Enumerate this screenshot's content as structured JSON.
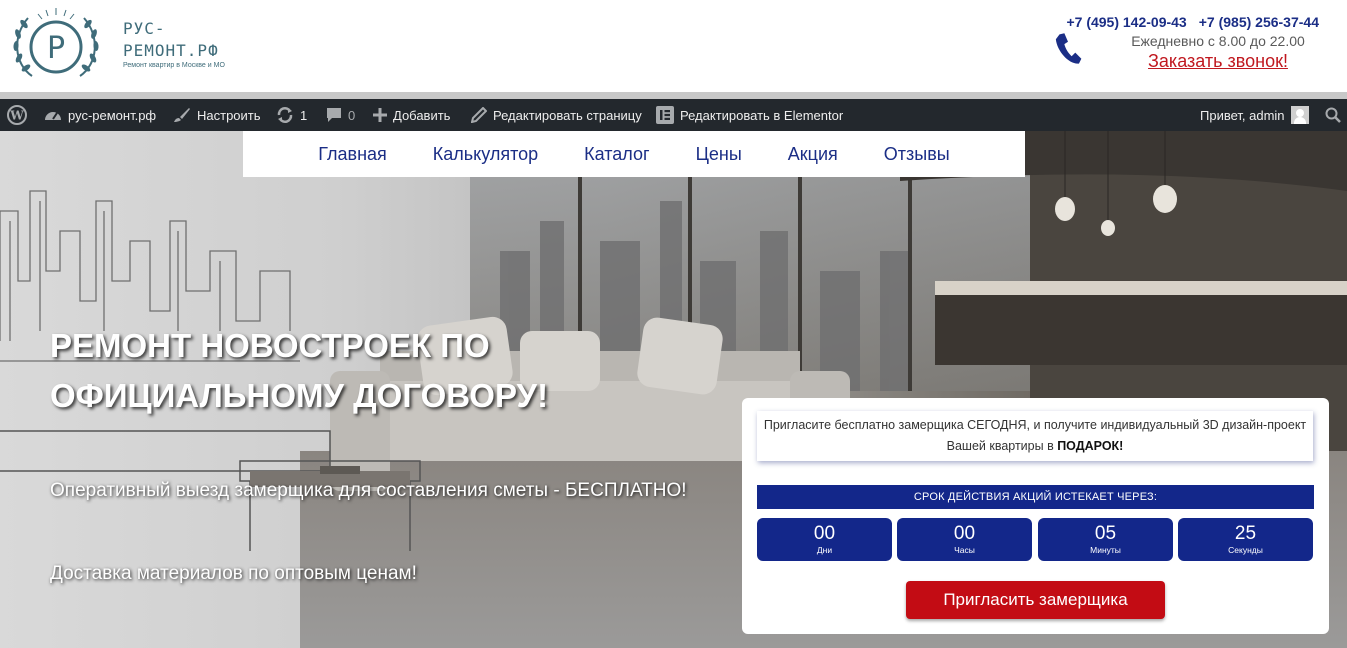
{
  "header": {
    "logo_line1": "РУС-",
    "logo_line2": "РЕМОНТ.РФ",
    "logo_tagline": "Ремонт квартир в Москве и МО",
    "phone1": "+7 (495) 142-09-43",
    "phone2": "+7 (985) 256-37-44",
    "hours": "Ежедневно с 8.00 до 22.00",
    "callback": "Заказать звонок!"
  },
  "admin_bar": {
    "site_name": "рус-ремонт.рф",
    "customize": "Настроить",
    "updates_count": "1",
    "comments_count": "0",
    "add_new": "Добавить",
    "edit_page": "Редактировать страницу",
    "edit_elementor": "Редактировать в Elementor",
    "greeting": "Привет, admin"
  },
  "nav": {
    "items": [
      "Главная",
      "Калькулятор",
      "Каталог",
      "Цены",
      "Акция",
      "Отзывы"
    ]
  },
  "hero": {
    "title": "Ремонт новостроек по официальному договору!",
    "line1": "Оперативный выезд замерщика для составления сметы - БЕСПЛАТНО!",
    "line2": "Доставка материалов по оптовым ценам!"
  },
  "promo": {
    "text_before": "Пригласите бесплатно замерщика СЕГОДНЯ, и получите индивидуальный 3D дизайн-проект Вашей квартиры в ",
    "text_bold": "ПОДАРОК!",
    "countdown_title": "СРОК ДЕЙСТВИЯ АКЦИЙ ИСТЕКАЕТ ЧЕРЕЗ:",
    "countdown": [
      {
        "value": "00",
        "unit": "Дни"
      },
      {
        "value": "00",
        "unit": "Часы"
      },
      {
        "value": "05",
        "unit": "Минуты"
      },
      {
        "value": "25",
        "unit": "Секунды"
      }
    ],
    "cta": "Пригласить замерщика"
  },
  "colors": {
    "brand_blue": "#1b2e86",
    "countdown_blue": "#13278a",
    "cta_red": "#c30c14",
    "callback_red": "#c0181f",
    "admin_bar_bg": "#23282d",
    "logo_teal": "#3f6c7a"
  },
  "icons": [
    "logo-emblem-icon",
    "phone-icon",
    "wordpress-icon",
    "dashboard-icon",
    "brush-icon",
    "updates-icon",
    "comment-icon",
    "plus-icon",
    "pencil-icon",
    "elementor-icon",
    "avatar-icon",
    "search-icon"
  ]
}
